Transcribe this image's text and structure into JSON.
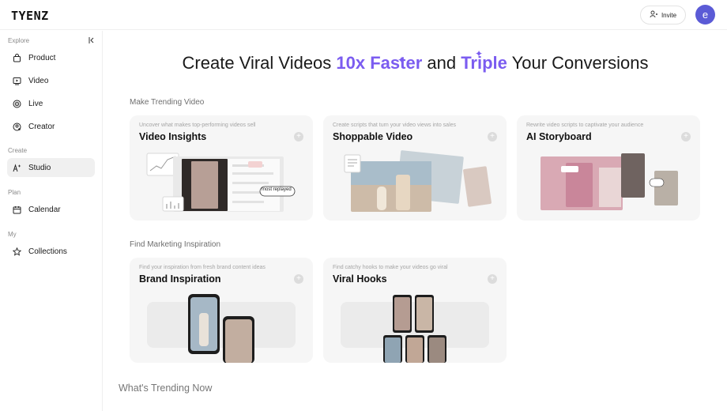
{
  "brand": {
    "logo": "TYENZ"
  },
  "header": {
    "invite_label": "Invite",
    "avatar_letter": "e"
  },
  "sidebar": {
    "sections": [
      {
        "label": "Explore",
        "items": [
          {
            "label": "Product",
            "icon": "bag-icon"
          },
          {
            "label": "Video",
            "icon": "video-icon"
          },
          {
            "label": "Live",
            "icon": "live-icon"
          },
          {
            "label": "Creator",
            "icon": "creator-icon"
          }
        ]
      },
      {
        "label": "Create",
        "items": [
          {
            "label": "Studio",
            "icon": "sparkle-ai-icon",
            "active": true
          }
        ]
      },
      {
        "label": "Plan",
        "items": [
          {
            "label": "Calendar",
            "icon": "calendar-icon"
          }
        ]
      },
      {
        "label": "My",
        "items": [
          {
            "label": "Collections",
            "icon": "star-icon"
          }
        ]
      }
    ]
  },
  "hero": {
    "part1": "Create Viral Videos ",
    "accent1": "10x Faster",
    "part2": " and ",
    "accent2": "Triple",
    "part3": " Your Conversions"
  },
  "groups": [
    {
      "title": "Make Trending Video",
      "cards": [
        {
          "subtitle": "Uncover what makes top-performing videos sell",
          "title": "Video Insights",
          "badge": "most replayed"
        },
        {
          "subtitle": "Create scripts that turn your video views into sales",
          "title": "Shoppable Video"
        },
        {
          "subtitle": "Rewrite video scripts to captivate your audience",
          "title": "AI Storyboard"
        }
      ]
    },
    {
      "title": "Find Marketing Inspiration",
      "cards": [
        {
          "subtitle": "Find your inspiration from fresh brand content ideas",
          "title": "Brand Inspiration"
        },
        {
          "subtitle": "Find catchy hooks to make your videos go viral",
          "title": "Viral Hooks"
        }
      ]
    }
  ],
  "trending": {
    "title": "What's Trending Now"
  },
  "accent_color": "#7b5cf0",
  "avatar_color": "#5b5bd6"
}
